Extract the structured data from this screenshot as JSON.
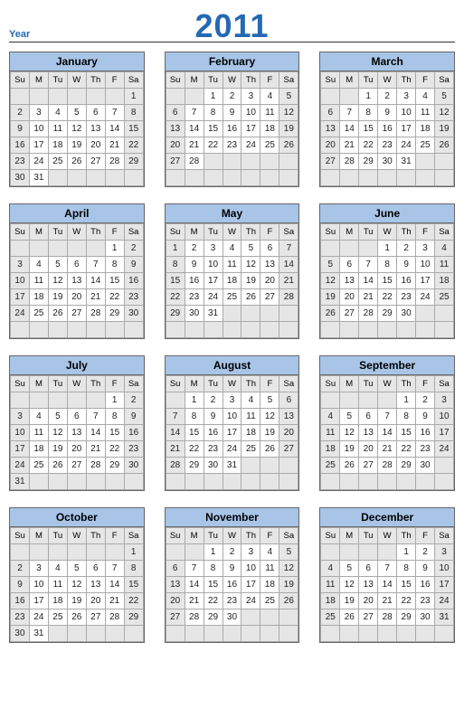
{
  "header": {
    "label": "Year",
    "value": "2011"
  },
  "weekdays": [
    "Su",
    "M",
    "Tu",
    "W",
    "Th",
    "F",
    "Sa"
  ],
  "months": [
    {
      "name": "January",
      "start": 6,
      "days": 31
    },
    {
      "name": "February",
      "start": 2,
      "days": 28
    },
    {
      "name": "March",
      "start": 2,
      "days": 31
    },
    {
      "name": "April",
      "start": 5,
      "days": 30
    },
    {
      "name": "May",
      "start": 0,
      "days": 31
    },
    {
      "name": "June",
      "start": 3,
      "days": 30
    },
    {
      "name": "July",
      "start": 5,
      "days": 31
    },
    {
      "name": "August",
      "start": 1,
      "days": 31
    },
    {
      "name": "September",
      "start": 4,
      "days": 30
    },
    {
      "name": "October",
      "start": 6,
      "days": 31
    },
    {
      "name": "November",
      "start": 2,
      "days": 30
    },
    {
      "name": "December",
      "start": 4,
      "days": 31
    }
  ]
}
